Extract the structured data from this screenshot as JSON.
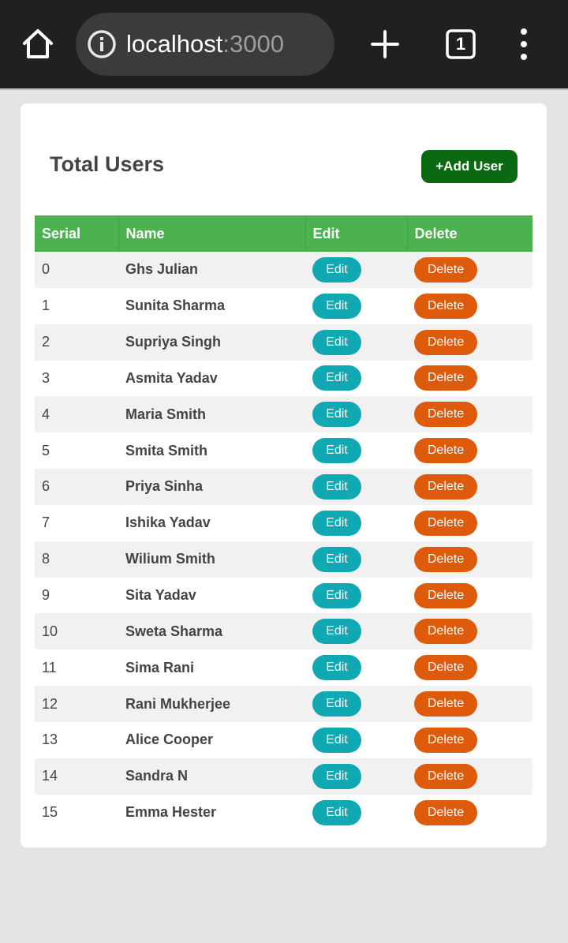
{
  "browser": {
    "url_host": "localhost",
    "url_port": ":3000",
    "tab_count": "1"
  },
  "page": {
    "title": "Total Users",
    "add_button_label": "+Add User"
  },
  "table": {
    "columns": [
      "Serial",
      "Name",
      "Edit",
      "Delete"
    ],
    "edit_label": "Edit",
    "delete_label": "Delete",
    "rows": [
      {
        "serial": "0",
        "name": "Ghs Julian"
      },
      {
        "serial": "1",
        "name": "Sunita Sharma"
      },
      {
        "serial": "2",
        "name": "Supriya Singh"
      },
      {
        "serial": "3",
        "name": "Asmita Yadav"
      },
      {
        "serial": "4",
        "name": "Maria Smith"
      },
      {
        "serial": "5",
        "name": "Smita Smith"
      },
      {
        "serial": "6",
        "name": "Priya Sinha"
      },
      {
        "serial": "7",
        "name": "Ishika Yadav"
      },
      {
        "serial": "8",
        "name": "Wilium Smith"
      },
      {
        "serial": "9",
        "name": "Sita Yadav"
      },
      {
        "serial": "10",
        "name": "Sweta Sharma"
      },
      {
        "serial": "11",
        "name": "Sima Rani"
      },
      {
        "serial": "12",
        "name": "Rani Mukherjee"
      },
      {
        "serial": "13",
        "name": "Alice Cooper"
      },
      {
        "serial": "14",
        "name": "Sandra N"
      },
      {
        "serial": "15",
        "name": "Emma Hester"
      }
    ]
  },
  "icons": {
    "home": "home-icon",
    "info": "info-icon",
    "new_tab": "plus-icon",
    "tabs": "tab-switcher-icon",
    "menu": "more-vert-icon"
  },
  "colors": {
    "toolbar": "#202020",
    "header_green": "#4cb24f",
    "add_button": "#0b6a11",
    "edit_button": "#0fa8b3",
    "delete_button": "#de5b0b"
  }
}
